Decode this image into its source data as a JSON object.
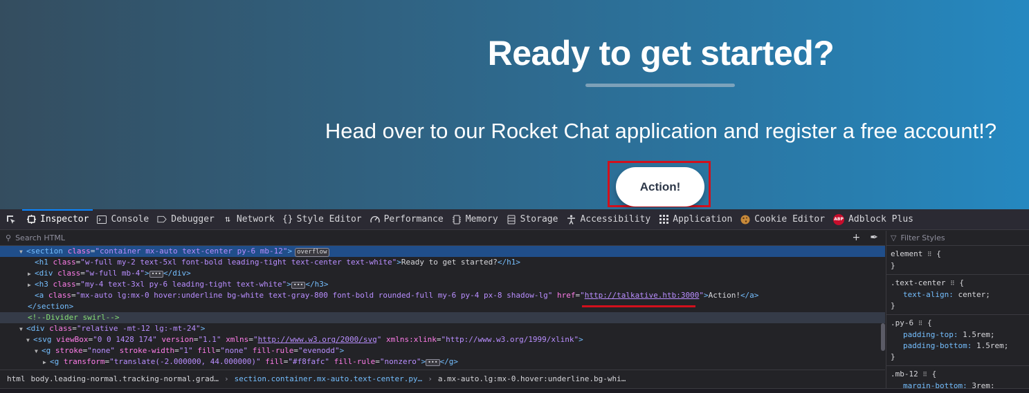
{
  "page": {
    "heading": "Ready to get started?",
    "subheading": "Head over to our Rocket Chat application and register a free account!?",
    "action_button": "Action!"
  },
  "toolbar": {
    "tabs": [
      {
        "label": "Inspector",
        "icon": "inspector-icon"
      },
      {
        "label": "Console",
        "icon": "console-icon"
      },
      {
        "label": "Debugger",
        "icon": "debugger-icon"
      },
      {
        "label": "Network",
        "icon": "network-icon"
      },
      {
        "label": "Style Editor",
        "icon": "style-editor-icon"
      },
      {
        "label": "Performance",
        "icon": "performance-icon"
      },
      {
        "label": "Memory",
        "icon": "memory-icon"
      },
      {
        "label": "Storage",
        "icon": "storage-icon"
      },
      {
        "label": "Accessibility",
        "icon": "accessibility-icon"
      },
      {
        "label": "Application",
        "icon": "application-icon"
      },
      {
        "label": "Cookie Editor",
        "icon": "cookie-icon"
      },
      {
        "label": "Adblock Plus",
        "icon": "adblock-icon"
      }
    ],
    "abp_badge": "ABP"
  },
  "markup": {
    "search_placeholder": "Search HTML",
    "overflow_badge": "overflow",
    "lines": {
      "section_open": {
        "tag": "<section",
        "attr": "class",
        "val": "\"container mx-auto text-center py-6 mb-12\"",
        "close": ">"
      },
      "h1": {
        "tag": "<h1",
        "attr": "class",
        "val": "\"w-full my-2 text-5xl font-bold leading-tight text-center text-white\"",
        "text": "Ready to get started?",
        "close": "</h1>"
      },
      "div_mb4": {
        "tag": "<div",
        "attr": "class",
        "val": "\"w-full mb-4\"",
        "close": "</div>"
      },
      "h3": {
        "tag": "<h3",
        "attr": "class",
        "val": "\"my-4 text-3xl py-6 leading-tight text-white\"",
        "close": "</h3>"
      },
      "a": {
        "tag": "<a",
        "attr": "class",
        "val": "\"mx-auto lg:mx-0 hover:underline bg-white text-gray-800 font-bold rounded-full my-6 py-4 px-8 shadow-lg\"",
        "attr2": "href",
        "href": "http://talkative.htb:3000",
        "text": "Action!",
        "close": "</a>"
      },
      "section_close": "</section>",
      "comment": "<!--Divider swirl-->",
      "div_relative": {
        "tag": "<div",
        "attr": "class",
        "val": "\"relative -mt-12 lg:-mt-24\""
      },
      "svg": {
        "tag": "<svg",
        "attr1": "viewBox",
        "val1": "\"0 0 1428 174\"",
        "attr2": "version",
        "val2": "\"1.1\"",
        "attr3": "xmlns",
        "val3": "http://www.w3.org/2000/svg",
        "attr4": "xmlns:xlink",
        "val4": "\"http://www.w3.org/1999/xlink\""
      },
      "g1": {
        "tag": "<g",
        "attr1": "stroke",
        "val1": "\"none\"",
        "attr2": "stroke-width",
        "val2": "\"1\"",
        "attr3": "fill",
        "val3": "\"none\"",
        "attr4": "fill-rule",
        "val4": "\"evenodd\""
      },
      "g2": {
        "tag": "<g",
        "attr1": "transform",
        "val1": "\"translate(-2.000000, 44.000000)\"",
        "attr2": "fill",
        "val2": "\"#f8fafc\"",
        "attr3": "fill-rule",
        "val3": "\"nonzero\"",
        "close": "</g>"
      }
    }
  },
  "breadcrumbs": [
    "html",
    "body.leading-normal.tracking-normal.grad…",
    "section.container.mx-auto.text-center.py…",
    "a.mx-auto.lg:mx-0.hover:underline.bg-whi…"
  ],
  "rules": {
    "filter_placeholder": "Filter Styles",
    "blocks": [
      {
        "selector": "element",
        "props": []
      },
      {
        "selector": ".text-center",
        "props": [
          {
            "name": "text-align",
            "value": "center;"
          }
        ]
      },
      {
        "selector": ".py-6",
        "props": [
          {
            "name": "padding-top",
            "value": "1.5rem;"
          },
          {
            "name": "padding-bottom",
            "value": "1.5rem;"
          }
        ]
      },
      {
        "selector": ".mb-12",
        "props": [
          {
            "name": "margin-bottom",
            "value": "3rem;"
          }
        ]
      }
    ]
  },
  "colors": {
    "accent": "#0a84ff",
    "highlight_red": "#d2101c",
    "selected_row": "#204e8a"
  }
}
